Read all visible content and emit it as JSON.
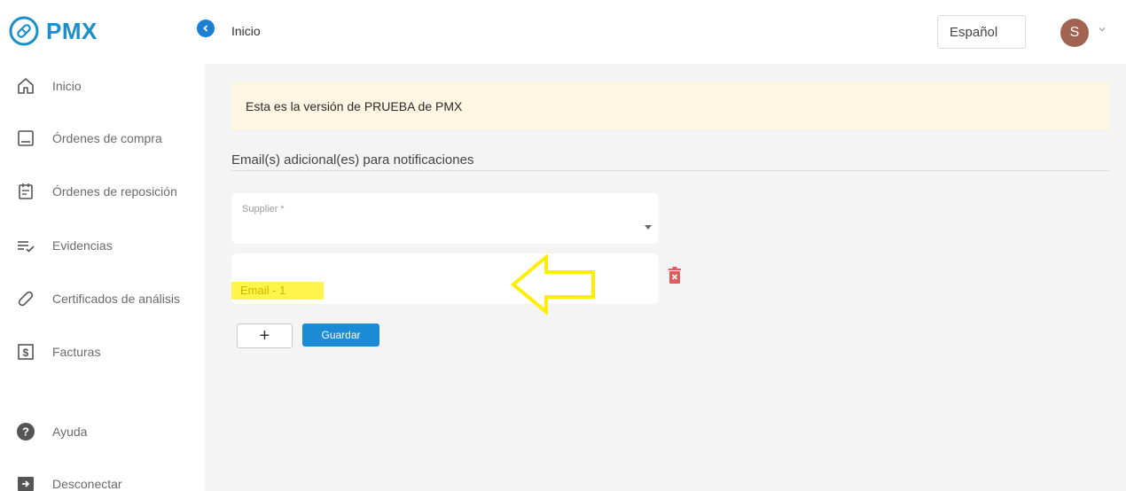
{
  "brand": {
    "name": "PMX"
  },
  "sidebar": {
    "items": [
      {
        "label": "Inicio",
        "icon": "home-icon"
      },
      {
        "label": "Órdenes de compra",
        "icon": "book-icon"
      },
      {
        "label": "Órdenes de reposición",
        "icon": "calendar-icon"
      },
      {
        "label": "Evidencias",
        "icon": "list-check-icon"
      },
      {
        "label": "Certificados de análisis",
        "icon": "link-icon"
      },
      {
        "label": "Facturas",
        "icon": "invoice-icon"
      }
    ],
    "bottom_items": [
      {
        "label": "Ayuda",
        "icon": "help-icon"
      },
      {
        "label": "Desconectar",
        "icon": "logout-icon"
      }
    ]
  },
  "topbar": {
    "title": "Inicio",
    "language": "Español",
    "avatar_initial": "S"
  },
  "main": {
    "banner": "Esta es la versión de PRUEBA de PMX",
    "section_title": "Email(s) adicional(es) para notificaciones",
    "supplier_label": "Supplier *",
    "email_placeholder": "Email - 1",
    "add_label": "+",
    "save_label": "Guardar"
  },
  "colors": {
    "brand": "#1a8fc8",
    "primary": "#1a8bd4",
    "avatar": "#a36352",
    "banner": "#fdf6e3",
    "delete": "#e05b5b",
    "highlight": "#fff54a"
  }
}
